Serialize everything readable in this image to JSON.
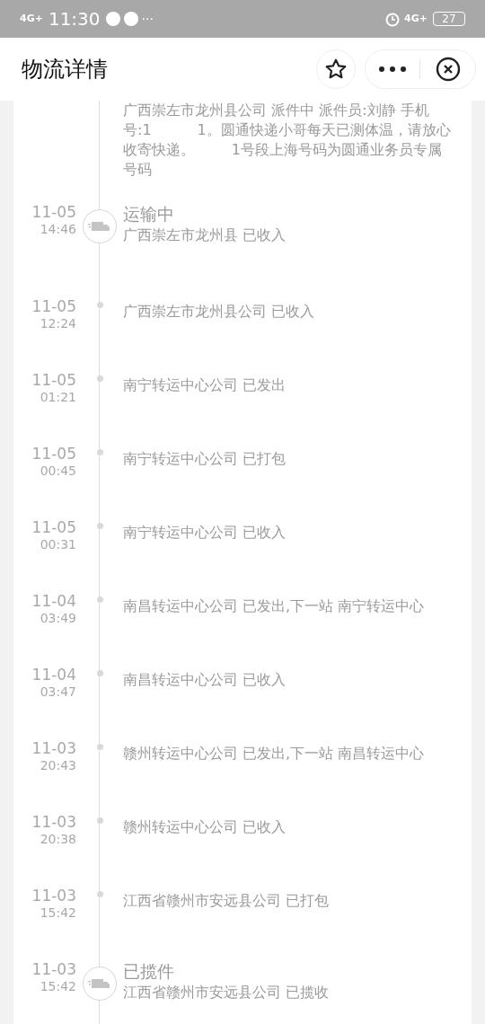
{
  "status_bar": {
    "network": "4G+",
    "time": "11:30",
    "more": "···",
    "network_right": "4G+",
    "battery": "27"
  },
  "header": {
    "title": "物流详情"
  },
  "partial_entry": {
    "text": "广西崇左市龙州县公司 派件中 派件员:刘静 手机号:1          1。圆通快递小哥每天已测体温，请放心收寄快递。        1号段上海号码为圆通业务员专属号码"
  },
  "entries": [
    {
      "kind": "major",
      "date": "11-05",
      "time": "14:46",
      "title": "运输中",
      "text": "广西崇左市龙州县 已收入"
    },
    {
      "kind": "minor",
      "date": "11-05",
      "time": "12:24",
      "text": "广西崇左市龙州县公司 已收入"
    },
    {
      "kind": "minor",
      "date": "11-05",
      "time": "01:21",
      "text": "南宁转运中心公司 已发出"
    },
    {
      "kind": "minor",
      "date": "11-05",
      "time": "00:45",
      "text": "南宁转运中心公司 已打包"
    },
    {
      "kind": "minor",
      "date": "11-05",
      "time": "00:31",
      "text": "南宁转运中心公司 已收入"
    },
    {
      "kind": "minor",
      "date": "11-04",
      "time": "03:49",
      "text": "南昌转运中心公司 已发出,下一站 南宁转运中心"
    },
    {
      "kind": "minor",
      "date": "11-04",
      "time": "03:47",
      "text": "南昌转运中心公司 已收入"
    },
    {
      "kind": "minor",
      "date": "11-03",
      "time": "20:43",
      "text": "赣州转运中心公司 已发出,下一站 南昌转运中心"
    },
    {
      "kind": "minor",
      "date": "11-03",
      "time": "20:38",
      "text": "赣州转运中心公司 已收入"
    },
    {
      "kind": "minor",
      "date": "11-03",
      "time": "15:42",
      "text": "江西省赣州市安远县公司 已打包"
    },
    {
      "kind": "major",
      "date": "11-03",
      "time": "15:42",
      "title": "已揽件",
      "text": "江西省赣州市安远县公司 已揽收"
    }
  ]
}
